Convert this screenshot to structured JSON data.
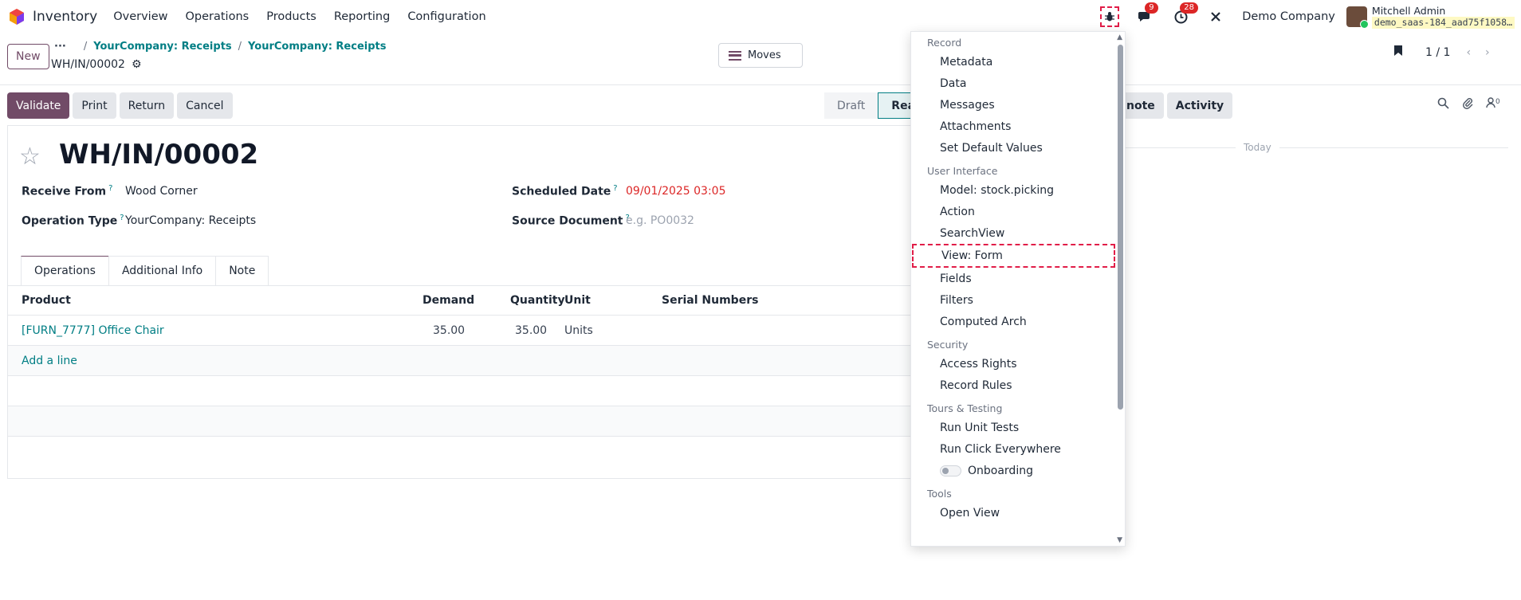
{
  "navbar": {
    "app_name": "Inventory",
    "menu": [
      "Overview",
      "Operations",
      "Products",
      "Reporting",
      "Configuration"
    ],
    "messages_count": "9",
    "activities_count": "28",
    "company": "Demo Company",
    "user_name": "Mitchell Admin",
    "database": "demo_saas-184_aad75f1058…",
    "icons": [
      "bug-icon",
      "chat-icon",
      "clock-icon",
      "tools-icon"
    ]
  },
  "control": {
    "new_label": "New",
    "breadcrumbs": [
      "YourCompany: Receipts",
      "YourCompany: Receipts"
    ],
    "record_name": "WH/IN/00002",
    "moves_label": "Moves",
    "pager": "1 / 1"
  },
  "statusbar": {
    "actions": [
      "Validate",
      "Print",
      "Return",
      "Cancel"
    ],
    "stages": [
      "Draft",
      "Rea"
    ],
    "chatter_buttons": [
      "note",
      "Activity"
    ],
    "followers_count": "0"
  },
  "form": {
    "title": "WH/IN/00002",
    "receive_from_label": "Receive From",
    "receive_from": "Wood Corner",
    "operation_type_label": "Operation Type",
    "operation_type": "YourCompany: Receipts",
    "scheduled_date_label": "Scheduled Date",
    "scheduled_date": "09/01/2025 03:05",
    "source_document_label": "Source Document",
    "source_document_placeholder": "e.g. PO0032",
    "help_mark": "?",
    "tabs": [
      "Operations",
      "Additional Info",
      "Note"
    ],
    "columns": [
      "Product",
      "Demand",
      "Quantity",
      "Unit",
      "Serial Numbers"
    ],
    "rows": [
      {
        "product": "[FURN_7777] Office Chair",
        "demand": "35.00",
        "quantity": "35.00",
        "unit": "Units"
      }
    ],
    "add_line": "Add a line"
  },
  "chatter": {
    "today": "Today"
  },
  "debug_menu": {
    "sections": [
      {
        "title": "Record",
        "items": [
          "Metadata",
          "Data",
          "Messages",
          "Attachments",
          "Set Default Values"
        ]
      },
      {
        "title": "User Interface",
        "items": [
          "Model: stock.picking",
          "Action",
          "SearchView",
          "View: Form",
          "Fields",
          "Filters",
          "Computed Arch"
        ]
      },
      {
        "title": "Security",
        "items": [
          "Access Rights",
          "Record Rules"
        ]
      },
      {
        "title": "Tours & Testing",
        "items": [
          "Run Unit Tests",
          "Run Click Everywhere",
          "Onboarding"
        ]
      },
      {
        "title": "Tools",
        "items": [
          "Open View"
        ]
      }
    ]
  },
  "colors": {
    "brand": "#714b67",
    "link": "#017e84",
    "danger": "#dc2626"
  }
}
